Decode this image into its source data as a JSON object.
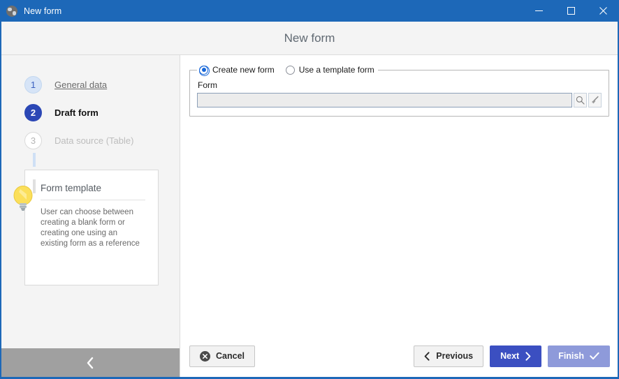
{
  "titlebar": {
    "icon": "globe-icon",
    "title": "New form",
    "minimize_label": "Minimize",
    "maximize_label": "Maximize",
    "close_label": "Close"
  },
  "header": {
    "title": "New form"
  },
  "sidebar": {
    "steps": [
      {
        "number": "1",
        "label": "General data",
        "state": "done"
      },
      {
        "number": "2",
        "label": "Draft form",
        "state": "active"
      },
      {
        "number": "3",
        "label": "Data source (Table)",
        "state": "todo"
      }
    ],
    "info_card": {
      "icon": "lightbulb-icon",
      "title": "Form template",
      "text": "User can choose between creating a blank form or creating one using an existing form as a reference"
    },
    "collapse_icon": "chevron-left-icon"
  },
  "main": {
    "radio_options": [
      {
        "label": "Create new form",
        "checked": true
      },
      {
        "label": "Use a template form",
        "checked": false
      }
    ],
    "form_field": {
      "label": "Form",
      "value": "",
      "placeholder": "",
      "search_icon": "magnifier-icon",
      "clear_icon": "broom-icon"
    }
  },
  "footer": {
    "cancel_label": "Cancel",
    "cancel_icon": "circle-x-icon",
    "previous_label": "Previous",
    "previous_icon": "chevron-left-icon",
    "next_label": "Next",
    "next_icon": "chevron-right-icon",
    "finish_label": "Finish",
    "finish_icon": "check-icon"
  },
  "colors": {
    "titlebar": "#1d68b8",
    "accent_primary": "#3b4fc1",
    "accent_disabled": "#8e9ada",
    "step_active": "#2b47b5",
    "step_done": "#d6e4f7",
    "sidebar_bg": "#f4f4f4",
    "sidebar_footer": "#a0a0a0"
  }
}
